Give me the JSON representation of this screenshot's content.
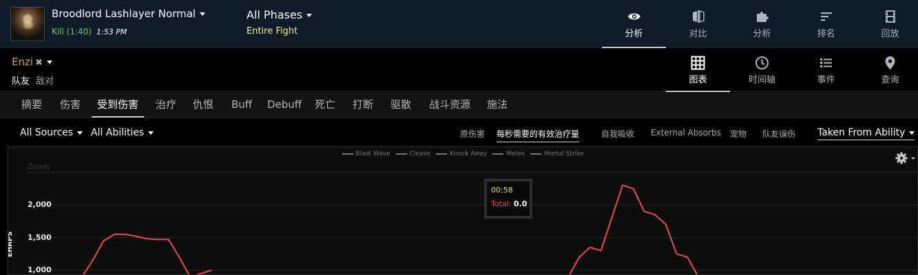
{
  "colors": {
    "kill": "#4cd84c",
    "phase_sub": "#f1f18a",
    "player_class": "#c79c6e",
    "series": "#e94b4b",
    "topbar_bg": "#0f1b2b"
  },
  "header": {
    "boss_icon": "boss-portrait",
    "boss_name": "Broodlord Lashlayer Normal",
    "fight_result": "Kill (1:40)",
    "fight_time": "1:53 PM",
    "phases": "All Phases",
    "phase_sub": "Entire Fight"
  },
  "topnav": [
    {
      "label": "分析",
      "icon": "eye-icon"
    },
    {
      "label": "对比",
      "icon": "compare-icon"
    },
    {
      "label": "分析",
      "icon": "puzzle-icon"
    },
    {
      "label": "排名",
      "icon": "rankings-icon"
    },
    {
      "label": "回放",
      "icon": "film-icon"
    }
  ],
  "player": {
    "name": "Enzi",
    "friendly": "队友",
    "enemy": "敌对"
  },
  "viewnav": [
    {
      "label": "图表",
      "icon": "grid-icon"
    },
    {
      "label": "时间轴",
      "icon": "clock-icon"
    },
    {
      "label": "事件",
      "icon": "list-icon"
    },
    {
      "label": "查询",
      "icon": "map-pin-icon"
    }
  ],
  "tabs": [
    "摘要",
    "伤害",
    "受到伤害",
    "治疗",
    "仇恨",
    "Buff",
    "Debuff",
    "死亡",
    "打断",
    "驱散",
    "战斗资源",
    "施法"
  ],
  "filters": {
    "sources": "All Sources",
    "abilities": "All Abilities"
  },
  "subtabs": [
    "原伤害",
    "每秒需要的有效治疗量",
    "自我吸收",
    "External Absorbs",
    "宠物",
    "队友误伤"
  ],
  "taken_from": "Taken From Ability",
  "chart": {
    "zoom_label": "Zoom",
    "tooltip": {
      "time": "00:58",
      "key": "Total:",
      "value": "0.0"
    }
  },
  "chart_data": {
    "type": "line",
    "title": "",
    "xlabel": "",
    "ylabel": "EHRPS",
    "legend": [
      "Blast Wave",
      "Cleave",
      "Knock Away",
      "Melee",
      "Mortal Strike"
    ],
    "legend_position": "top-center",
    "yticks": [
      "2,000",
      "1,500",
      "1,000"
    ],
    "grid": true,
    "series": [
      {
        "name": "Total",
        "color": "#e94b4b",
        "points": [
          [
            0,
            900
          ],
          [
            1,
            1150
          ],
          [
            2,
            1450
          ],
          [
            3,
            1550
          ],
          [
            4,
            1550
          ],
          [
            5,
            1520
          ],
          [
            6,
            1480
          ],
          [
            7,
            1470
          ],
          [
            8,
            1470
          ],
          [
            9,
            1200
          ],
          [
            10,
            900
          ],
          [
            11,
            950
          ],
          [
            12,
            1000
          ],
          [
            45,
            900
          ],
          [
            46,
            1200
          ],
          [
            47,
            1350
          ],
          [
            48,
            1300
          ],
          [
            49,
            1800
          ],
          [
            50,
            2300
          ],
          [
            51,
            2250
          ],
          [
            52,
            1900
          ],
          [
            53,
            1850
          ],
          [
            54,
            1700
          ],
          [
            55,
            1250
          ],
          [
            56,
            1200
          ],
          [
            57,
            900
          ]
        ]
      }
    ]
  }
}
